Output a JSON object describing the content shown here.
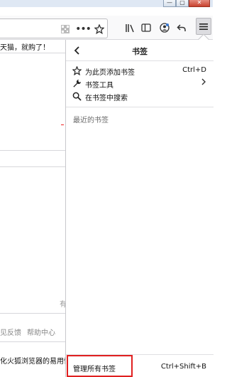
{
  "window": {
    "min_glyph": "—",
    "max_glyph": "▢",
    "close_glyph": "✕"
  },
  "page": {
    "text_fragment": "天猫，就购了！",
    "right_fragment": "有",
    "footer_links": [
      "见反馈",
      "帮助中心"
    ],
    "bottom_fragment": "化火狐浏览器的易用性"
  },
  "toolbar": {
    "icons": [
      "qr-code-icon",
      "more-dots-icon",
      "bookmark-star-icon",
      "library-icon",
      "sidebar-icon",
      "account-icon",
      "undo-icon",
      "hamburger-menu-icon"
    ]
  },
  "panel": {
    "back_glyph": "‹",
    "title": "书签",
    "items": [
      {
        "label": "为此页添加书签",
        "shortcut": "Ctrl+D",
        "icon": "star-icon"
      },
      {
        "label": "书签工具",
        "shortcut": "",
        "icon": "wrench-icon",
        "has_submenu": true
      },
      {
        "label": "在书签中搜索",
        "shortcut": "",
        "icon": "search-icon"
      }
    ],
    "recent_label": "最近的书签",
    "manage": {
      "label": "管理所有书签",
      "shortcut": "Ctrl+Shift+B"
    }
  },
  "colors": {
    "highlight": "#e02020",
    "accent_red": "#ee2222"
  }
}
